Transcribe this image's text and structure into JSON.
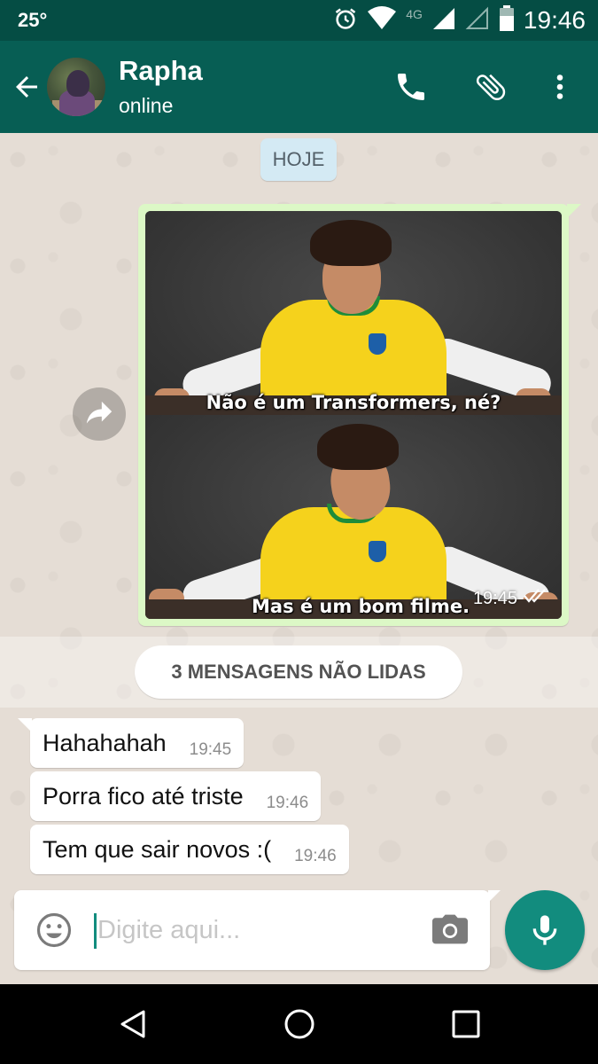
{
  "status_bar": {
    "temperature": "25°",
    "network_label": "4G",
    "time": "19:46"
  },
  "header": {
    "contact_name": "Rapha",
    "contact_status": "online",
    "icons": [
      "back-arrow-icon",
      "phone-icon",
      "paperclip-icon",
      "more-vert-icon"
    ]
  },
  "chat": {
    "date_label": "HOJE",
    "outgoing_media": {
      "caption_top": "Não é um Transformers, né?",
      "caption_bottom": "Mas é um bom filme.",
      "time": "19:45",
      "status_icon": "double-check-icon"
    },
    "unread_label": "3 MENSAGENS NÃO LIDAS",
    "incoming": [
      {
        "text": "Hahahahah",
        "time": "19:45"
      },
      {
        "text": "Porra fico até triste",
        "time": "19:46"
      },
      {
        "text": "Tem que sair novos :(",
        "time": "19:46"
      }
    ]
  },
  "composer": {
    "placeholder": "Digite aqui...",
    "icons": [
      "emoji-icon",
      "camera-icon",
      "mic-icon"
    ]
  },
  "nav": {
    "icons": [
      "nav-back-icon",
      "nav-home-icon",
      "nav-recents-icon"
    ]
  },
  "colors": {
    "header": "#075e54",
    "status_bar": "#054d44",
    "outgoing_bubble": "#dcf8c6",
    "accent": "#128c7e",
    "chat_bg": "#e5ddd5"
  }
}
